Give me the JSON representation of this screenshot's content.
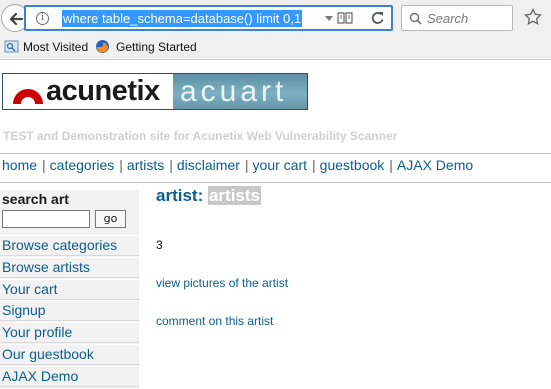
{
  "browser": {
    "url": "where table_schema=database() limit 0,1",
    "search_placeholder": "Search",
    "bookmarks": [
      "Most Visited",
      "Getting Started"
    ]
  },
  "site": {
    "logo_left": "acunetix",
    "logo_right": "acuart",
    "tagline": "TEST and Demonstration site for Acunetix Web Vulnerability Scanner",
    "top_menu": [
      "home",
      "categories",
      "artists",
      "disclaimer",
      "your cart",
      "guestbook",
      "AJAX Demo"
    ],
    "colors": {
      "link": "#0b5d8e",
      "url_highlight": "#3399ff",
      "logo_red": "#cc0000"
    }
  },
  "sidebar": {
    "search_title": "search art",
    "search_button": "go",
    "items": [
      "Browse categories",
      "Browse artists",
      "Your cart",
      "Signup",
      "Your profile",
      "Our guestbook",
      "AJAX Demo"
    ]
  },
  "content": {
    "title_prefix": "artist:",
    "title_value": "artists",
    "count": "3",
    "links": [
      "view pictures of the artist",
      "comment on this artist"
    ]
  }
}
